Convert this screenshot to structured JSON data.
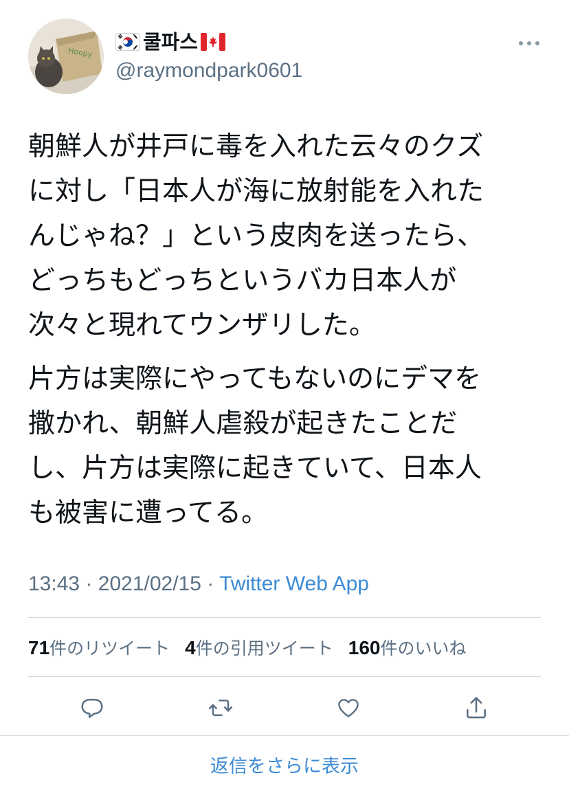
{
  "author": {
    "display_name": "쿨파스",
    "handle": "@raymondpark0601",
    "flag_left": "south-korea-flag-icon",
    "flag_right": "canada-flag-icon"
  },
  "tweet": {
    "paragraphs": [
      {
        "lines": [
          "朝鮮人が井戸に毒を入れた云々のクズ",
          "に対し「日本人が海に放射能を入れた",
          "んじゃね？」という皮肉を送ったら、",
          "どっちもどっちというバカ日本人が",
          "次々と現れてウンザリした。"
        ]
      },
      {
        "lines": [
          "片方は実際にやってもないのにデマを",
          "撒かれ、朝鮮人虐殺が起きたことだ",
          "し、片方は実際に起きていて、日本人",
          "も被害に遭ってる。"
        ]
      }
    ],
    "time": "13:43",
    "date": "2021/02/15",
    "separator": "·",
    "source": "Twitter Web App"
  },
  "stats": [
    {
      "count": "71",
      "label": "件のリツイート"
    },
    {
      "count": "4",
      "label": "件の引用ツイート"
    },
    {
      "count": "160",
      "label": "件のいいね"
    }
  ],
  "actions": {
    "reply_icon": "reply-icon",
    "retweet_icon": "retweet-icon",
    "like_icon": "heart-icon",
    "share_icon": "share-icon"
  },
  "more_replies_label": "返信をさらに表示",
  "colors": {
    "text": "#0f1419",
    "secondary": "#5b7083",
    "link": "#3d8bd4",
    "divider": "#cfd9de"
  }
}
